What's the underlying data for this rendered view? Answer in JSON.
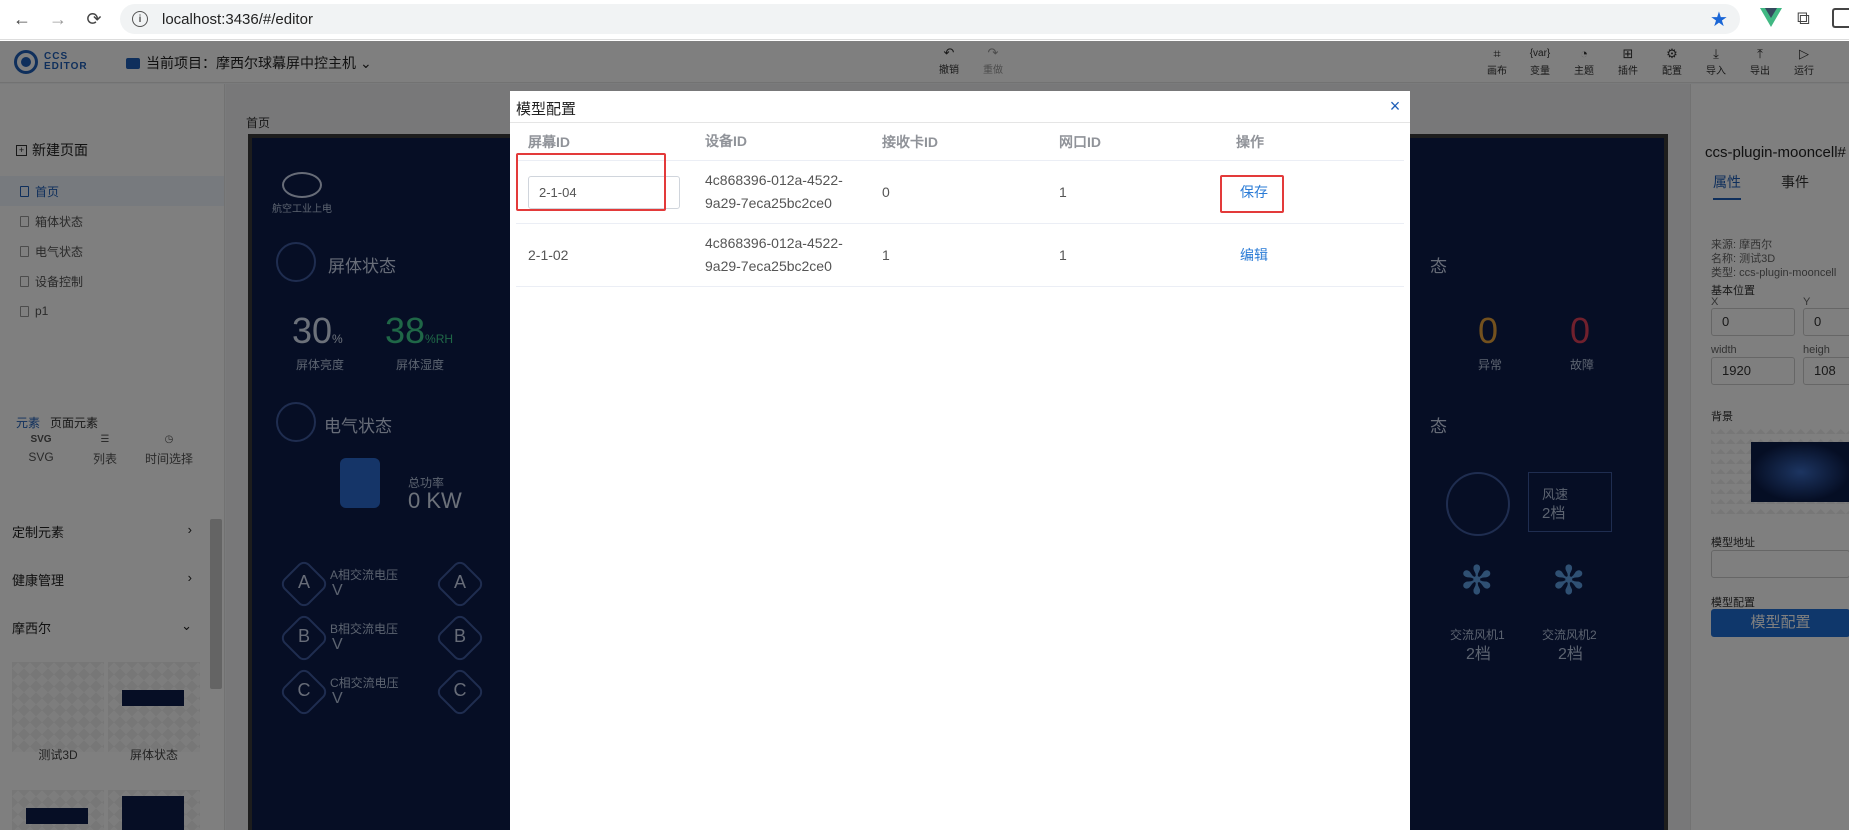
{
  "browser": {
    "url": "localhost:3436/#/editor",
    "back_glyph": "←",
    "forward_glyph": "→",
    "reload_glyph": "⟳",
    "info_glyph": "i",
    "star_glyph": "★",
    "puzzle_glyph": "⧉"
  },
  "topbar": {
    "logo_line1": "CCS",
    "logo_line2": "EDITOR",
    "project_label": "当前项目：摩西尔球幕屏中控主机",
    "chevron": "⌄",
    "undo": {
      "glyph": "↶",
      "label": "撤销"
    },
    "redo": {
      "glyph": "↷",
      "label": "重做"
    },
    "tools": [
      {
        "glyph": "⌗",
        "label": "画布"
      },
      {
        "glyph": "{var}",
        "label": "变量"
      },
      {
        "glyph": "◔",
        "label": "主题"
      },
      {
        "glyph": "⊞",
        "label": "插件"
      },
      {
        "glyph": "⚙",
        "label": "配置"
      },
      {
        "glyph": "⤓",
        "label": "导入"
      },
      {
        "glyph": "⤒",
        "label": "导出"
      },
      {
        "glyph": "▷",
        "label": "运行"
      }
    ]
  },
  "left": {
    "new_page": "新建页面",
    "new_page_glyph": "+",
    "pages": [
      "首页",
      "箱体状态",
      "电气状态",
      "设备控制",
      "p1"
    ],
    "tab_elements": "元素",
    "tab_page_elements": "页面元素",
    "el_icons": [
      {
        "glyph": "SVG",
        "label": "SVG"
      },
      {
        "glyph": "☰",
        "label": "列表"
      },
      {
        "glyph": "◷",
        "label": "时间选择"
      }
    ],
    "categories": [
      "定制元素",
      "健康管理",
      "摩西尔"
    ],
    "cat_chev_right": "›",
    "cat_chev_down": "⌄",
    "thumbs": [
      "测试3D",
      "屏体状态"
    ]
  },
  "canvas": {
    "breadcrumb": "首页",
    "brand": "航空工业上电",
    "section1": "屏体状态",
    "section2": "电气状态",
    "section_right": "态",
    "brightness_value": "30",
    "brightness_unit": "%",
    "brightness_label": "屏体亮度",
    "humidity_value": "38",
    "humidity_unit": "%RH",
    "humidity_label": "屏体湿度",
    "abnormal_value": "0",
    "abnormal_label": "异常",
    "fault_value": "0",
    "fault_label": "故障",
    "power_label": "总功率",
    "power_value": "0 KW",
    "phases": [
      {
        "letter": "A",
        "label": "A相交流电压",
        "unit": "V"
      },
      {
        "letter": "B",
        "label": "B相交流电压",
        "unit": "V"
      },
      {
        "letter": "C",
        "label": "C相交流电压",
        "unit": "V"
      }
    ],
    "wind_label": "风速",
    "wind_value": "2档",
    "fan1_label": "交流风机1",
    "fan1_value": "2档",
    "fan2_label": "交流风机2",
    "fan2_value": "2档",
    "fan_glyph": "✻"
  },
  "right": {
    "title": "ccs-plugin-mooncell#",
    "tab_props": "属性",
    "tab_events": "事件",
    "source": "来源: 摩西尔",
    "name": "名称: 测试3D",
    "type": "类型: ccs-plugin-mooncell",
    "base_pos": "基本位置",
    "x_label": "X",
    "y_label": "Y",
    "x_value": "0",
    "y_value": "0",
    "width_label": "width",
    "height_label": "heigh",
    "width_value": "1920",
    "height_value": "108",
    "background": "背景",
    "model_addr": "模型地址",
    "model_config": "模型配置",
    "model_config_btn": "模型配置"
  },
  "dialog": {
    "title": "模型配置",
    "close_glyph": "×",
    "headers": [
      "屏幕ID",
      "设备ID",
      "接收卡ID",
      "网口ID",
      "操作"
    ],
    "rows": [
      {
        "screen_id": "2-1-04",
        "device_id_1": "4c868396-012a-4522-",
        "device_id_2": "9a29-7eca25bc2ce0",
        "card_id": "0",
        "port_id": "1",
        "action": "保存"
      },
      {
        "screen_id": "2-1-02",
        "device_id_1": "4c868396-012a-4522-",
        "device_id_2": "9a29-7eca25bc2ce0",
        "card_id": "1",
        "port_id": "1",
        "action": "编辑"
      }
    ]
  },
  "colors": {
    "accent": "#1f5fb8",
    "link": "#2a7bd6",
    "highlight": "#e33a3a",
    "screen_bg": "#0c1d4a"
  }
}
